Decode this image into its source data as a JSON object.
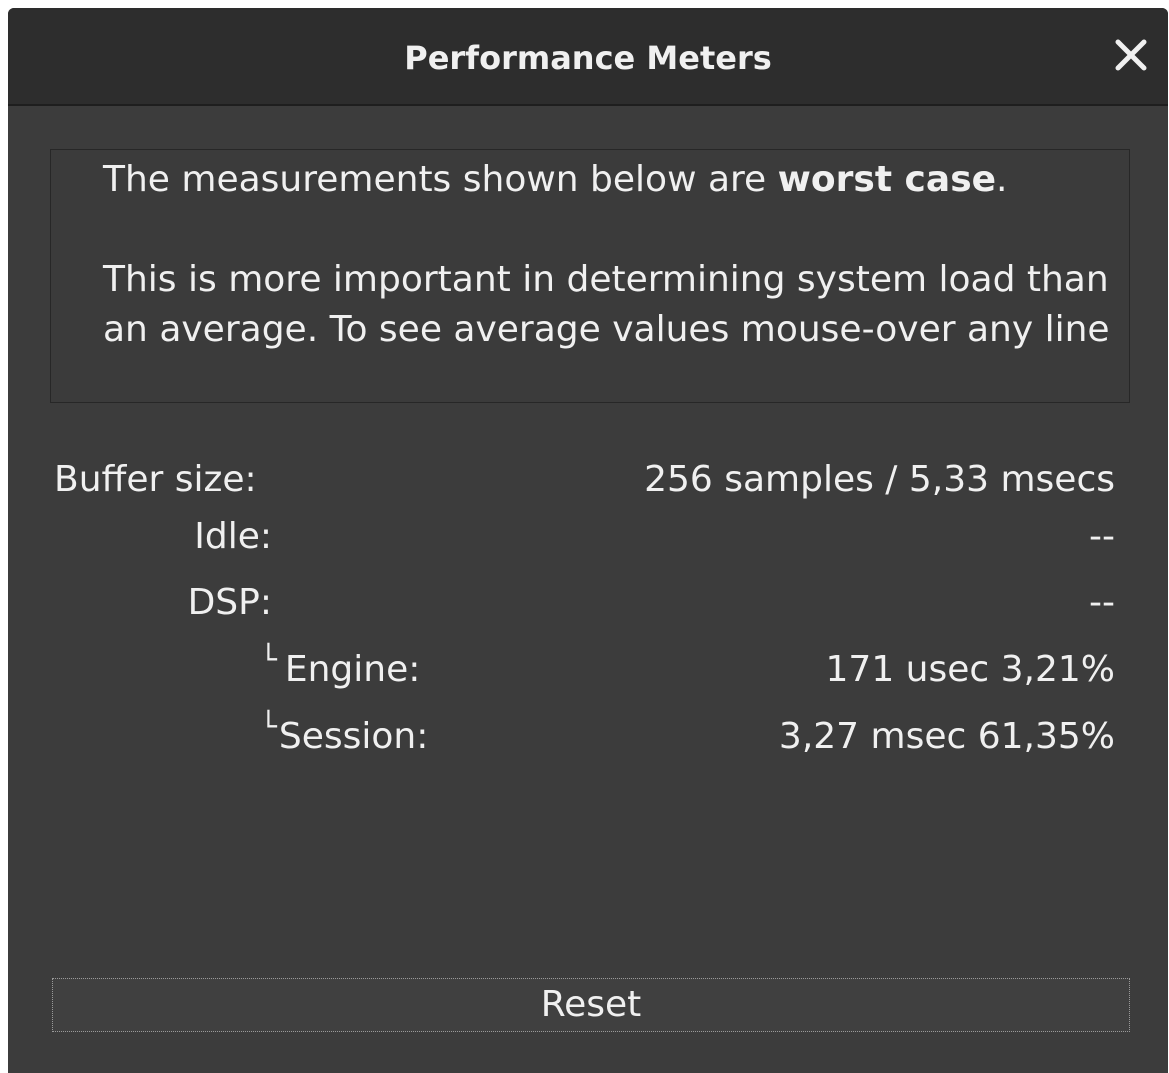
{
  "window": {
    "title": "Performance Meters"
  },
  "notice": {
    "line1_prefix": "The measurements shown below are ",
    "line1_bold": "worst case",
    "line1_suffix": ".",
    "line2": "This is more important in determining system load than an average. To see average values mouse-over any line"
  },
  "meters": {
    "buffer_size": {
      "label": "Buffer size:",
      "value": "256 samples /  5,33 msecs"
    },
    "idle": {
      "label": "Idle:",
      "value": "--"
    },
    "dsp": {
      "label": "DSP:",
      "value": "--"
    },
    "engine": {
      "tree": "└",
      "label": "Engine:",
      "value": "171 usec  3,21%"
    },
    "session": {
      "tree": "└",
      "label": "Session:",
      "value": "3,27 msec 61,35%"
    }
  },
  "actions": {
    "reset_label": "Reset"
  },
  "icons": {
    "close": "close-icon"
  },
  "colors": {
    "background": "#3c3c3c",
    "titlebar": "#2d2d2d",
    "text": "#f0f0f0"
  }
}
